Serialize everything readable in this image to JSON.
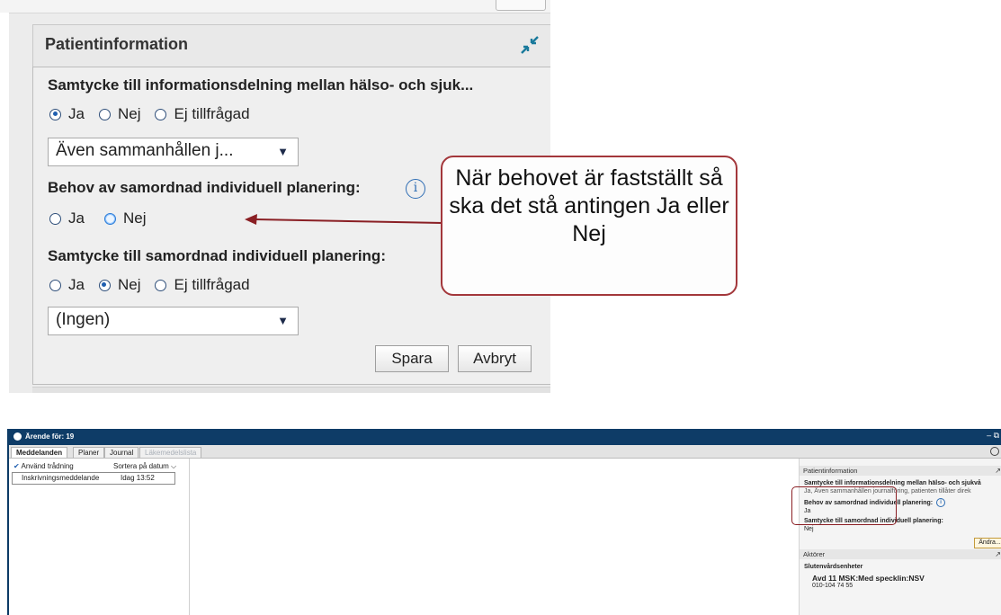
{
  "zoom_panel": {
    "title": "Patientinformation",
    "collapse_icon": "collapse-arrows-icon",
    "q1": {
      "label": "Samtycke till informationsdelning mellan hälso- och sjuk...",
      "options": [
        "Ja",
        "Nej",
        "Ej tillfrågad"
      ],
      "selected": "Ja"
    },
    "q1_select": "Även sammanhållen j...",
    "q2": {
      "label": "Behov av samordnad individuell planering:",
      "options": [
        "Ja",
        "Nej"
      ],
      "selected": null,
      "hovered": "Nej"
    },
    "q3": {
      "label": "Samtycke till samordnad individuell planering:",
      "options": [
        "Ja",
        "Nej",
        "Ej tillfrågad"
      ],
      "selected": "Nej"
    },
    "q3_select": "(Ingen)",
    "save_label": "Spara",
    "cancel_label": "Avbryt",
    "dropdown_arrow": "▼",
    "info_glyph": "i"
  },
  "callout": {
    "text": "När behovet är fastställt så ska det stå antingen Ja eller Nej",
    "border_color": "#a3373b"
  },
  "app": {
    "title": "Ärende för: 19",
    "window_controls": "– ⧉",
    "tabs": [
      "Meddelanden",
      "Planer",
      "Journal",
      "Läkemedelslista"
    ],
    "active_tab": "Meddelanden",
    "disabled_tab": "Läkemedelslista",
    "threading_label": "Använd trådning",
    "sort_label": "Sortera på datum",
    "sort_chevron": "⌵",
    "messages": [
      {
        "title": "Inskrivningsmeddelande",
        "date": "Idag 13:52"
      }
    ],
    "right_panel": {
      "section1_title": "Patientinformation",
      "consent_label": "Samtycke till informationsdelning mellan hälso- och sjukvå",
      "consent_value": "Ja, Även sammanhållen journalföring, patienten tillåter direk",
      "need_label": "Behov av samordnad individuell planering:",
      "need_value": "Ja",
      "planning_consent_label": "Samtycke till samordnad individuell planering:",
      "planning_consent_value": "Nej",
      "change_button": "Ändra...",
      "section2_title": "Aktörer",
      "unit_heading": "Slutenvårdsenheter",
      "unit_name": "Avd 11 MSK:Med specklin:NSV",
      "unit_phone": "010-104 74 55"
    },
    "colors": {
      "titlebar": "#0e3c67",
      "highlight": "#8a1f24"
    }
  }
}
